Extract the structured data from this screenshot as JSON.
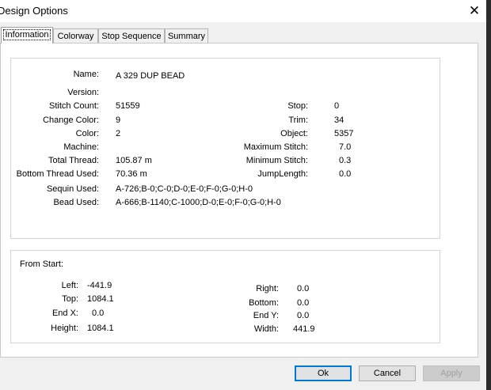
{
  "window": {
    "title": "Design Options",
    "close_glyph": "✕",
    "close_icon": "close-icon"
  },
  "tabs": [
    {
      "label": "Information",
      "active": true
    },
    {
      "label": "Colorway"
    },
    {
      "label": "Stop Sequence"
    },
    {
      "label": "Summary"
    }
  ],
  "info": {
    "name_label": "Name:",
    "name_value": "A 329 DUP BEAD",
    "version_label": "Version:",
    "version_value": "",
    "stitch_count_label": "Stitch Count:",
    "stitch_count_value": "51559",
    "change_color_label": "Change Color:",
    "change_color_value": "9",
    "color_label": "Color:",
    "color_value": "2",
    "machine_label": "Machine:",
    "machine_value": "",
    "total_thread_label": "Total Thread:",
    "total_thread_value": "105.87 m",
    "bottom_thread_label": "Bottom Thread Used:",
    "bottom_thread_value": "70.36 m",
    "sequin_label": "Sequin Used:",
    "sequin_value": "A-726;B-0;C-0;D-0;E-0;F-0;G-0;H-0",
    "bead_label": "Bead Used:",
    "bead_value": "A-666;B-1140;C-1000;D-0;E-0;F-0;G-0;H-0",
    "stop_label": "Stop:",
    "stop_value": "0",
    "trim_label": "Trim:",
    "trim_value": "34",
    "object_label": "Object:",
    "object_value": "5357",
    "max_stitch_label": "Maximum Stitch:",
    "max_stitch_value": "7.0",
    "min_stitch_label": "Minimum Stitch:",
    "min_stitch_value": "0.3",
    "jump_length_label": "JumpLength:",
    "jump_length_value": "0.0"
  },
  "from_start": {
    "heading": "From Start:",
    "left_label": "Left:",
    "left_value": "-441.9",
    "top_label": "Top:",
    "top_value": "1084.1",
    "end_x_label": "End X:",
    "end_x_value": "0.0",
    "height_label": "Height:",
    "height_value": "1084.1",
    "right_label": "Right:",
    "right_value": "0.0",
    "bottom_label": "Bottom:",
    "bottom_value": "0.0",
    "end_y_label": "End Y:",
    "end_y_value": "0.0",
    "width_label": "Width:",
    "width_value": "441.9"
  },
  "buttons": {
    "ok": "Ok",
    "cancel": "Cancel",
    "apply": "Apply"
  },
  "colors": {
    "accent": "#0078d7",
    "window_bg": "#f0f0f0",
    "page_bg": "#ffffff"
  }
}
